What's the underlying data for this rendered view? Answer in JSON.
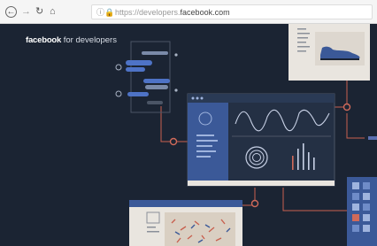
{
  "browser": {
    "back_icon": "back-arrow-icon",
    "forward_icon": "forward-arrow-icon",
    "reload_icon": "reload-icon",
    "home_icon": "home-icon",
    "url_protocol": "https://developers.",
    "url_domain": "facebook.com",
    "secure_color": "#3a9a3a"
  },
  "header": {
    "brand": "facebook",
    "brand_suffix": " for developers"
  },
  "colors": {
    "background": "#1b2433",
    "accent_blue": "#3b5998",
    "connector": "#d06a5a",
    "panel": "#e9e5df"
  }
}
